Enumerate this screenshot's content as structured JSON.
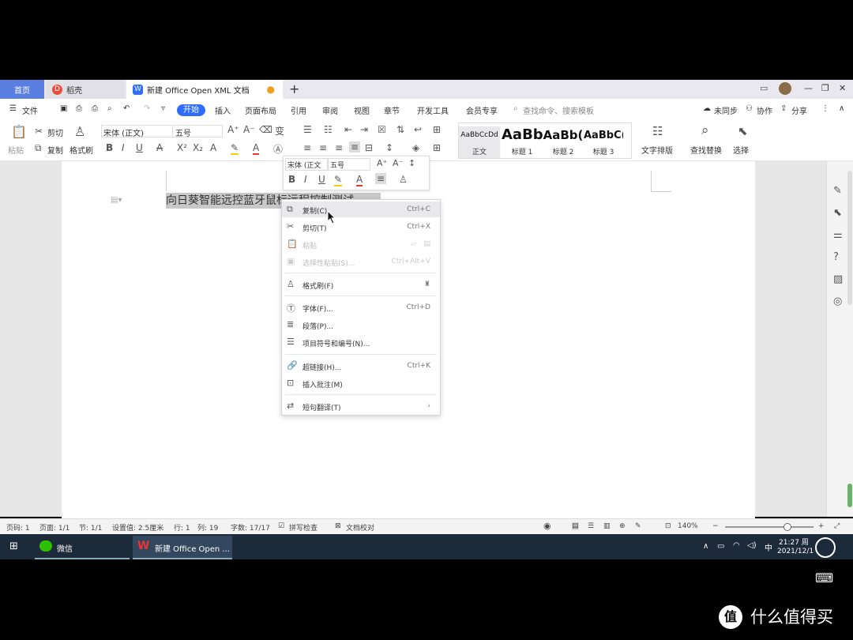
{
  "tabs": {
    "home": "首页",
    "daoke": "稻壳",
    "doc": "新建 Office Open XML 文档",
    "new_tab": "+"
  },
  "window_controls": {
    "minimize": "—",
    "restore": "❐",
    "close": "✕"
  },
  "menubar": {
    "file": "文件",
    "items": [
      "开始",
      "插入",
      "页面布局",
      "引用",
      "审阅",
      "视图",
      "章节",
      "开发工具",
      "会员专享"
    ],
    "search_placeholder": "查找命令、搜索模板",
    "sync": "未同步",
    "collab": "协作",
    "share": "分享"
  },
  "ribbon": {
    "paste": "粘贴",
    "cut": "剪切",
    "copy": "复制",
    "format_painter": "格式刷",
    "font_name": "宋体 (正文)",
    "font_size": "五号",
    "styles": [
      {
        "sample": "AaBbCcDd",
        "caption": "正文"
      },
      {
        "sample": "AaBb",
        "caption": "标题 1"
      },
      {
        "sample": "AaBb(",
        "caption": "标题 2"
      },
      {
        "sample": "AaBbC(",
        "caption": "标题 3"
      }
    ],
    "text_layout": "文字排版",
    "find_replace": "查找替换",
    "select": "选择"
  },
  "document": {
    "selected_text": "向日葵智能远控蓝牙鼠标远程控制测试"
  },
  "mini_toolbar": {
    "font_name": "宋体 (正文",
    "font_size": "五号"
  },
  "context_menu": [
    {
      "label": "复制(C)",
      "shortcut": "Ctrl+C",
      "icon": "copy-icon",
      "enabled": true
    },
    {
      "label": "剪切(T)",
      "shortcut": "Ctrl+X",
      "icon": "scissors-icon",
      "enabled": true
    },
    {
      "label": "粘贴",
      "shortcut": "",
      "icon": "paste-icon",
      "enabled": false
    },
    {
      "label": "选择性粘贴(S)...",
      "shortcut": "Ctrl+Alt+V",
      "icon": "paste-special-icon",
      "enabled": false
    },
    {
      "label": "格式刷(F)",
      "shortcut": "",
      "icon": "format-painter-icon",
      "enabled": true
    },
    {
      "label": "字体(F)...",
      "shortcut": "Ctrl+D",
      "icon": "font-icon",
      "enabled": true
    },
    {
      "label": "段落(P)...",
      "shortcut": "",
      "icon": "paragraph-icon",
      "enabled": true
    },
    {
      "label": "项目符号和编号(N)...",
      "shortcut": "",
      "icon": "list-icon",
      "enabled": true
    },
    {
      "label": "超链接(H)...",
      "shortcut": "Ctrl+K",
      "icon": "link-icon",
      "enabled": true
    },
    {
      "label": "插入批注(M)",
      "shortcut": "",
      "icon": "comment-icon",
      "enabled": true
    },
    {
      "label": "短句翻译(T)",
      "shortcut": "›",
      "icon": "translate-icon",
      "enabled": true
    }
  ],
  "statusbar": {
    "page_num": "页码: 1",
    "pages": "页面: 1/1",
    "section": "节: 1/1",
    "setting": "设置值: 2.5厘米",
    "row": "行: 1",
    "col": "列: 19",
    "words": "字数: 17/17",
    "spell": "拼写检查",
    "proof": "文档校对",
    "zoom": "140%",
    "zoom_level": 0.7
  },
  "taskbar": {
    "wechat": "微信",
    "wps": "新建 Office Open ...",
    "ime": "中",
    "time": "21:27 周",
    "date": "2021/12/1"
  },
  "watermark": {
    "logo": "值",
    "text": "什么值得买"
  }
}
